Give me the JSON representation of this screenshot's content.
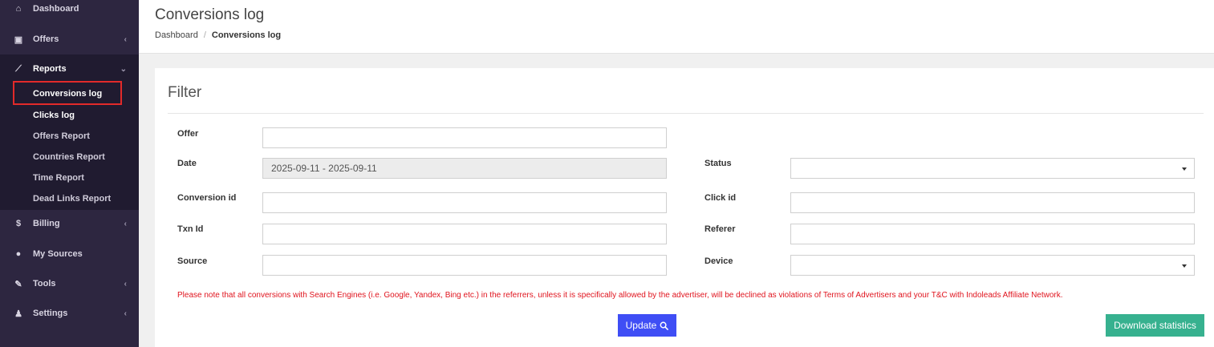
{
  "sidebar": {
    "items": [
      {
        "label": "Dashboard",
        "icon": "home-icon",
        "glyph": "⌂"
      },
      {
        "label": "Offers",
        "icon": "money-icon",
        "glyph": "▣",
        "chevron": "‹"
      },
      {
        "label": "Reports",
        "icon": "line-chart-icon",
        "glyph": "⟋",
        "chevron": "⌄"
      },
      {
        "label": "Billing",
        "icon": "dollar-icon",
        "glyph": "$",
        "chevron": "‹"
      },
      {
        "label": "My Sources",
        "icon": "globe-icon",
        "glyph": "●"
      },
      {
        "label": "Tools",
        "icon": "wrench-icon",
        "glyph": "✎",
        "chevron": "‹"
      },
      {
        "label": "Settings",
        "icon": "user-icon",
        "glyph": "♟",
        "chevron": "‹"
      }
    ],
    "report_subitems": [
      "Conversions log",
      "Clicks log",
      "Offers Report",
      "Countries Report",
      "Time Report",
      "Dead Links Report"
    ]
  },
  "header": {
    "title": "Conversions log",
    "breadcrumb": {
      "root": "Dashboard",
      "separator": "/",
      "current": "Conversions log"
    }
  },
  "filter": {
    "title": "Filter",
    "fields": {
      "offer": {
        "label": "Offer",
        "value": ""
      },
      "date": {
        "label": "Date",
        "value": "2025-09-11 - 2025-09-11"
      },
      "status": {
        "label": "Status",
        "value": ""
      },
      "conversion_id": {
        "label": "Conversion id",
        "value": ""
      },
      "click_id": {
        "label": "Click id",
        "value": ""
      },
      "txn_id": {
        "label": "Txn Id",
        "value": ""
      },
      "referer": {
        "label": "Referer",
        "value": ""
      },
      "source": {
        "label": "Source",
        "value": ""
      },
      "device": {
        "label": "Device",
        "value": ""
      }
    },
    "notice": "Please note that all conversions with Search Engines (i.e. Google, Yandex, Bing etc.) in the referrers, unless it is specifically allowed by the advertiser, will be declined as violations of Terms of Advertisers and your T&C with Indoleads Affiliate Network.",
    "update_label": "Update",
    "download_label": "Download statistics"
  },
  "colors": {
    "sidebar_bg": "#2d2640",
    "highlight": "#e22a2a",
    "update_button": "#3f4ef5",
    "download_button": "#37b18f",
    "notice_text": "#e0141e"
  }
}
